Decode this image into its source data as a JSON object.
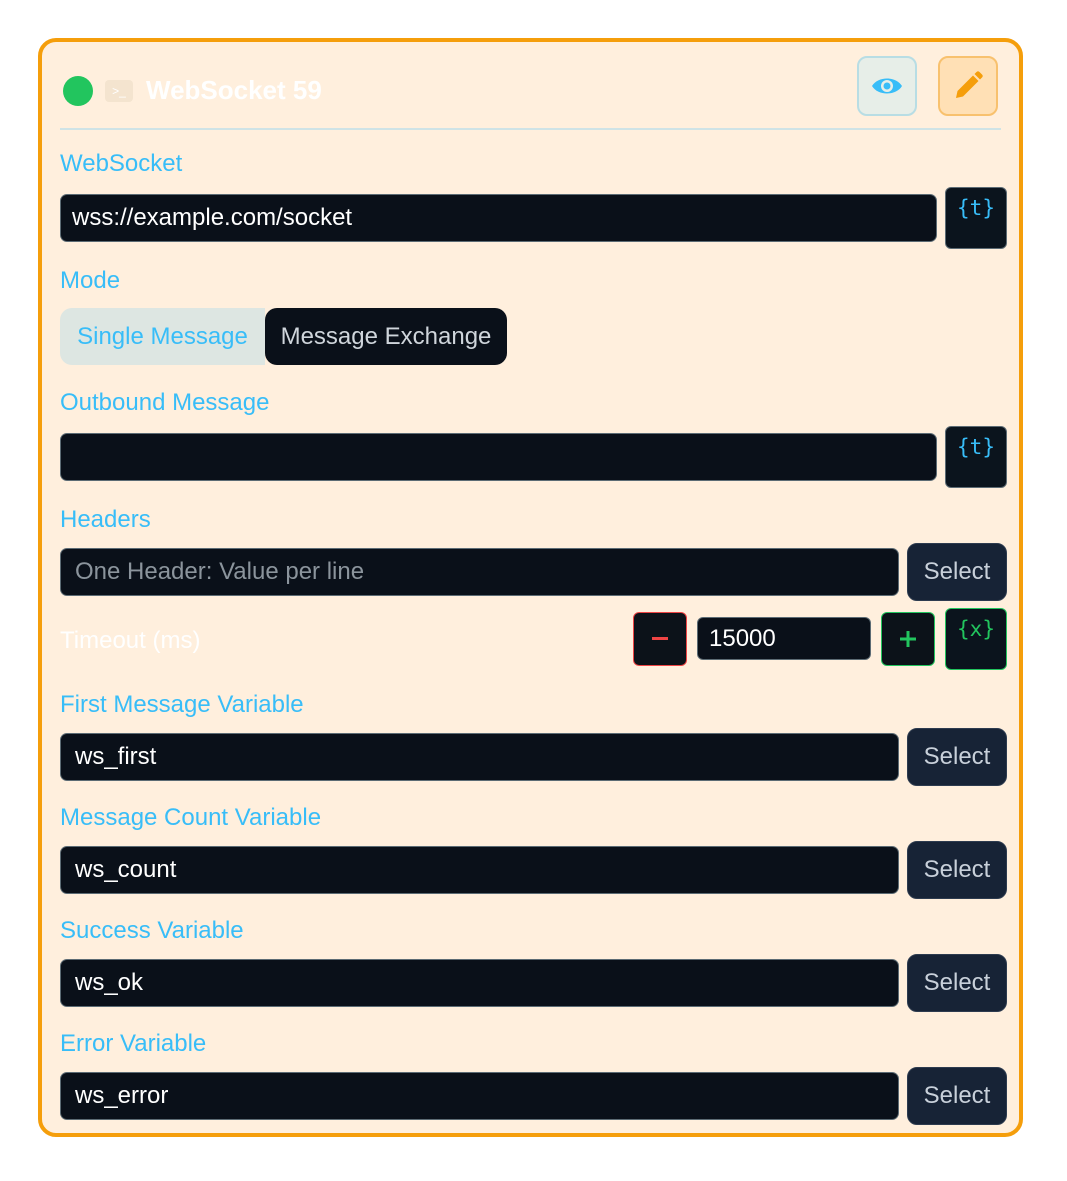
{
  "node": {
    "title": "WebSocket 59",
    "icons": {
      "status": "status-dot-icon",
      "type": "terminal-icon",
      "view": "eye-icon",
      "edit": "pencil-icon"
    },
    "colors": {
      "accent": "#f59e0b",
      "label": "#38bdf8",
      "status": "#22c55e",
      "field_bg": "#0a1019"
    }
  },
  "websocket": {
    "label": "WebSocket",
    "value": "wss://example.com/socket",
    "template_button": "{t}"
  },
  "mode": {
    "label": "Mode",
    "options": [
      "Single Message",
      "Message Exchange"
    ],
    "selected": "Single Message"
  },
  "outbound": {
    "label": "Outbound Message",
    "value": "",
    "template_button": "{t}"
  },
  "headers": {
    "label": "Headers",
    "placeholder": "One Header: Value per line",
    "select_label": "Select"
  },
  "timeout": {
    "label": "Timeout (ms)",
    "value": "15000",
    "decrement_label": "−",
    "increment_label": "+",
    "variable_button": "{x}"
  },
  "first_message_var": {
    "label": "First Message Variable",
    "value": "ws_first",
    "select_label": "Select"
  },
  "message_count_var": {
    "label": "Message Count Variable",
    "value": "ws_count",
    "select_label": "Select"
  },
  "success_var": {
    "label": "Success Variable",
    "value": "ws_ok",
    "select_label": "Select"
  },
  "error_var": {
    "label": "Error Variable",
    "value": "ws_error",
    "select_label": "Select"
  }
}
